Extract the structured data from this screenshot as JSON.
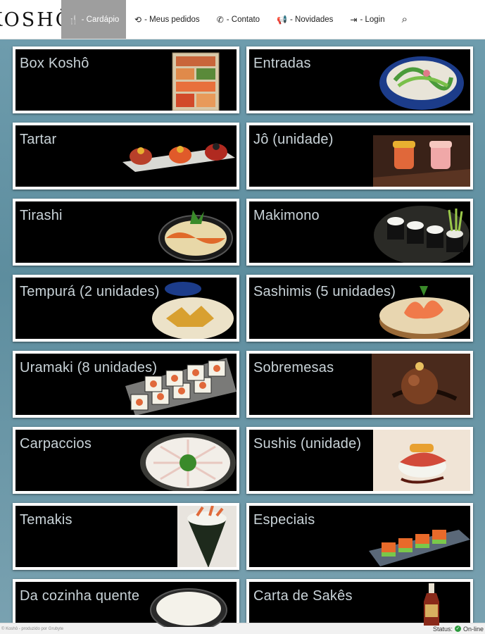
{
  "brand": {
    "logo_text": "KOSHŌ"
  },
  "nav": [
    {
      "icon": "utensils-icon",
      "glyph": "🍴",
      "label": "- Cardápio",
      "active": true
    },
    {
      "icon": "refresh-orders-icon",
      "glyph": "⟲",
      "label": "- Meus pedidos",
      "active": false
    },
    {
      "icon": "phone-icon",
      "glyph": "✆",
      "label": "- Contato",
      "active": false
    },
    {
      "icon": "megaphone-icon",
      "glyph": "📢",
      "label": "- Novidades",
      "active": false
    },
    {
      "icon": "login-icon",
      "glyph": "⇥",
      "label": "- Login",
      "active": false
    }
  ],
  "search": {
    "icon": "search-icon",
    "glyph": "⌕"
  },
  "categories": [
    {
      "name": "Box Koshô",
      "photo": "bento-box"
    },
    {
      "name": "Entradas",
      "photo": "salad-bowl"
    },
    {
      "name": "Tartar",
      "photo": "tartar-plate"
    },
    {
      "name": "Jô (unidade)",
      "photo": "jo-pieces"
    },
    {
      "name": "Tirashi",
      "photo": "tirashi-bowl"
    },
    {
      "name": "Makimono",
      "photo": "makimono-plate"
    },
    {
      "name": "Tempurá (2 unidades)",
      "photo": "tempura-plate"
    },
    {
      "name": "Sashimis (5 unidades)",
      "photo": "sashimi-board"
    },
    {
      "name": "Uramaki (8 unidades)",
      "photo": "uramaki-tray"
    },
    {
      "name": "Sobremesas",
      "photo": "chocolate-dessert"
    },
    {
      "name": "Carpaccios",
      "photo": "carpaccio-plate"
    },
    {
      "name": "Sushis (unidade)",
      "photo": "sushi-pieces"
    },
    {
      "name": "Temakis",
      "photo": "temaki-cone"
    },
    {
      "name": "Especiais",
      "photo": "especiais-plate"
    },
    {
      "name": "Da cozinha quente",
      "photo": "rice-bowl"
    },
    {
      "name": "Carta de Sakês",
      "photo": "sake-bottle"
    }
  ],
  "footer": {
    "credit": "© Koshô - produzido por Grubyte",
    "status_label": "Status:",
    "status_value": "On-line"
  }
}
